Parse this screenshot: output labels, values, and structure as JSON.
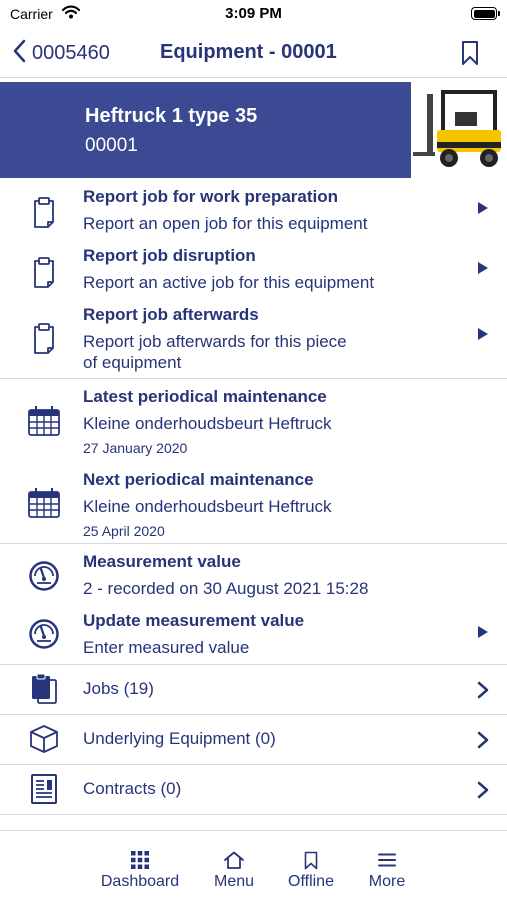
{
  "status_bar": {
    "carrier": "Carrier",
    "time": "3:09 PM"
  },
  "nav": {
    "back_label": "0005460",
    "title": "Equipment - 00001"
  },
  "header": {
    "name": "Heftruck 1 type 35",
    "code": "00001"
  },
  "actions": [
    {
      "title": "Report job for work preparation",
      "subtitle": "Report an open job for this equipment",
      "icon": "clipboard-icon"
    },
    {
      "title": "Report job disruption",
      "subtitle": "Report an active job for this equipment",
      "icon": "clipboard-icon"
    },
    {
      "title": "Report job afterwards",
      "subtitle_line1": "Report job afterwards for this piece",
      "subtitle_line2": "of equipment",
      "icon": "clipboard-icon"
    }
  ],
  "maintenance": [
    {
      "title": "Latest periodical maintenance",
      "subtitle": "Kleine onderhoudsbeurt Heftruck",
      "date": "27 January 2020",
      "icon": "calendar-icon"
    },
    {
      "title": "Next periodical maintenance",
      "subtitle": "Kleine onderhoudsbeurt Heftruck",
      "date": "25 April 2020",
      "icon": "calendar-icon"
    }
  ],
  "measurement": {
    "title": "Measurement value",
    "value": "2  - recorded on 30 August 2021 15:28",
    "update_title": "Update measurement value",
    "update_subtitle": "Enter measured value",
    "icon": "gauge-icon"
  },
  "links": [
    {
      "label": "Jobs (19)",
      "icon": "jobs-icon"
    },
    {
      "label": "Underlying  Equipment (0)",
      "icon": "box-icon"
    },
    {
      "label": "Contracts (0)",
      "icon": "contract-icon"
    }
  ],
  "tabs": [
    {
      "label": "Dashboard",
      "icon": "grid-icon"
    },
    {
      "label": "Menu",
      "icon": "home-icon"
    },
    {
      "label": "Offline",
      "icon": "bookmark-icon"
    },
    {
      "label": "More",
      "icon": "hamburger-icon"
    }
  ],
  "colors": {
    "accent": "#27347a",
    "header_band": "#3b4a92",
    "divider": "#d8d8dc",
    "forklift_yellow": "#f5c400"
  }
}
